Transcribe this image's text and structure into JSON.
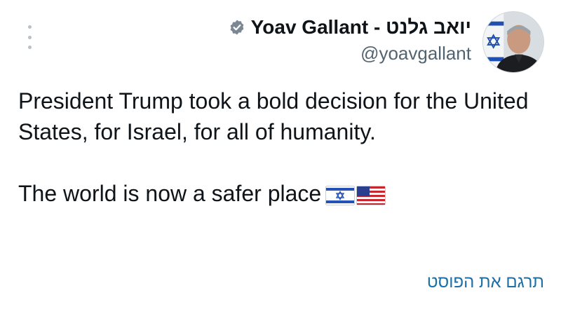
{
  "author": {
    "display_name": "Yoav Gallant - יואב גלנט",
    "handle": "@yoavgallant",
    "verified_icon": "verified-badge-icon",
    "avatar": "profile-photo"
  },
  "menu": {
    "icon": "more-vertical-icon"
  },
  "tweet": {
    "paragraph1": "President Trump took a bold decision for the United States, for Israel, for all of humanity.",
    "paragraph2": "The world is now a safer place",
    "emoji": [
      "israel-flag-icon",
      "us-flag-icon"
    ]
  },
  "translate_label": "תרגם את הפוסט",
  "colors": {
    "text": "#0f1419",
    "secondary": "#536471",
    "link": "#1d6fa5",
    "badge": "#7b8792"
  }
}
